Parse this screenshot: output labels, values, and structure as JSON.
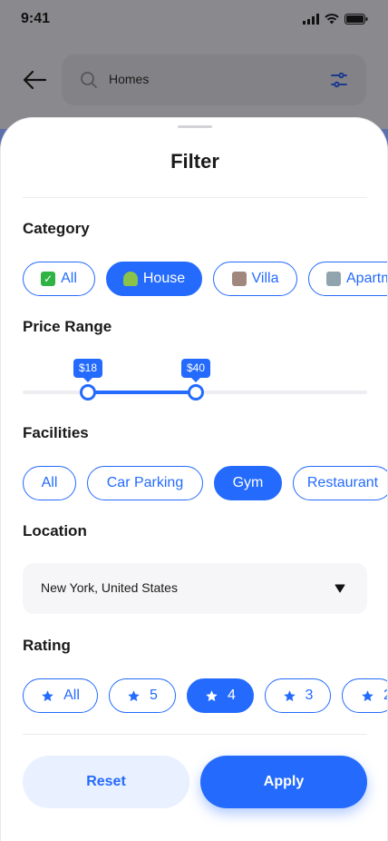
{
  "status_bar": {
    "time": "9:41"
  },
  "search": {
    "value": "Homes"
  },
  "sheet": {
    "title": "Filter"
  },
  "category": {
    "heading": "Category",
    "items": [
      {
        "label": "All",
        "icon": "check-emoji",
        "active": false
      },
      {
        "label": "House",
        "icon": "house-emoji",
        "active": true
      },
      {
        "label": "Villa",
        "icon": "villa-emoji",
        "active": false
      },
      {
        "label": "Apartm",
        "icon": "building-emoji",
        "active": false
      }
    ]
  },
  "price": {
    "heading": "Price Range",
    "min_label": "$18",
    "max_label": "$40"
  },
  "facilities": {
    "heading": "Facilities",
    "items": [
      {
        "label": "All",
        "active": false
      },
      {
        "label": "Car Parking",
        "active": false
      },
      {
        "label": "Gym",
        "active": true
      },
      {
        "label": "Restaurant",
        "active": false
      }
    ]
  },
  "location": {
    "heading": "Location",
    "value": "New York, United States"
  },
  "rating": {
    "heading": "Rating",
    "items": [
      {
        "label": "All",
        "active": false
      },
      {
        "label": "5",
        "active": false
      },
      {
        "label": "4",
        "active": true
      },
      {
        "label": "3",
        "active": false
      },
      {
        "label": "2",
        "active": false
      }
    ]
  },
  "actions": {
    "reset": "Reset",
    "apply": "Apply"
  },
  "colors": {
    "accent": "#246BFD",
    "soft_accent": "#E9F0FF"
  }
}
